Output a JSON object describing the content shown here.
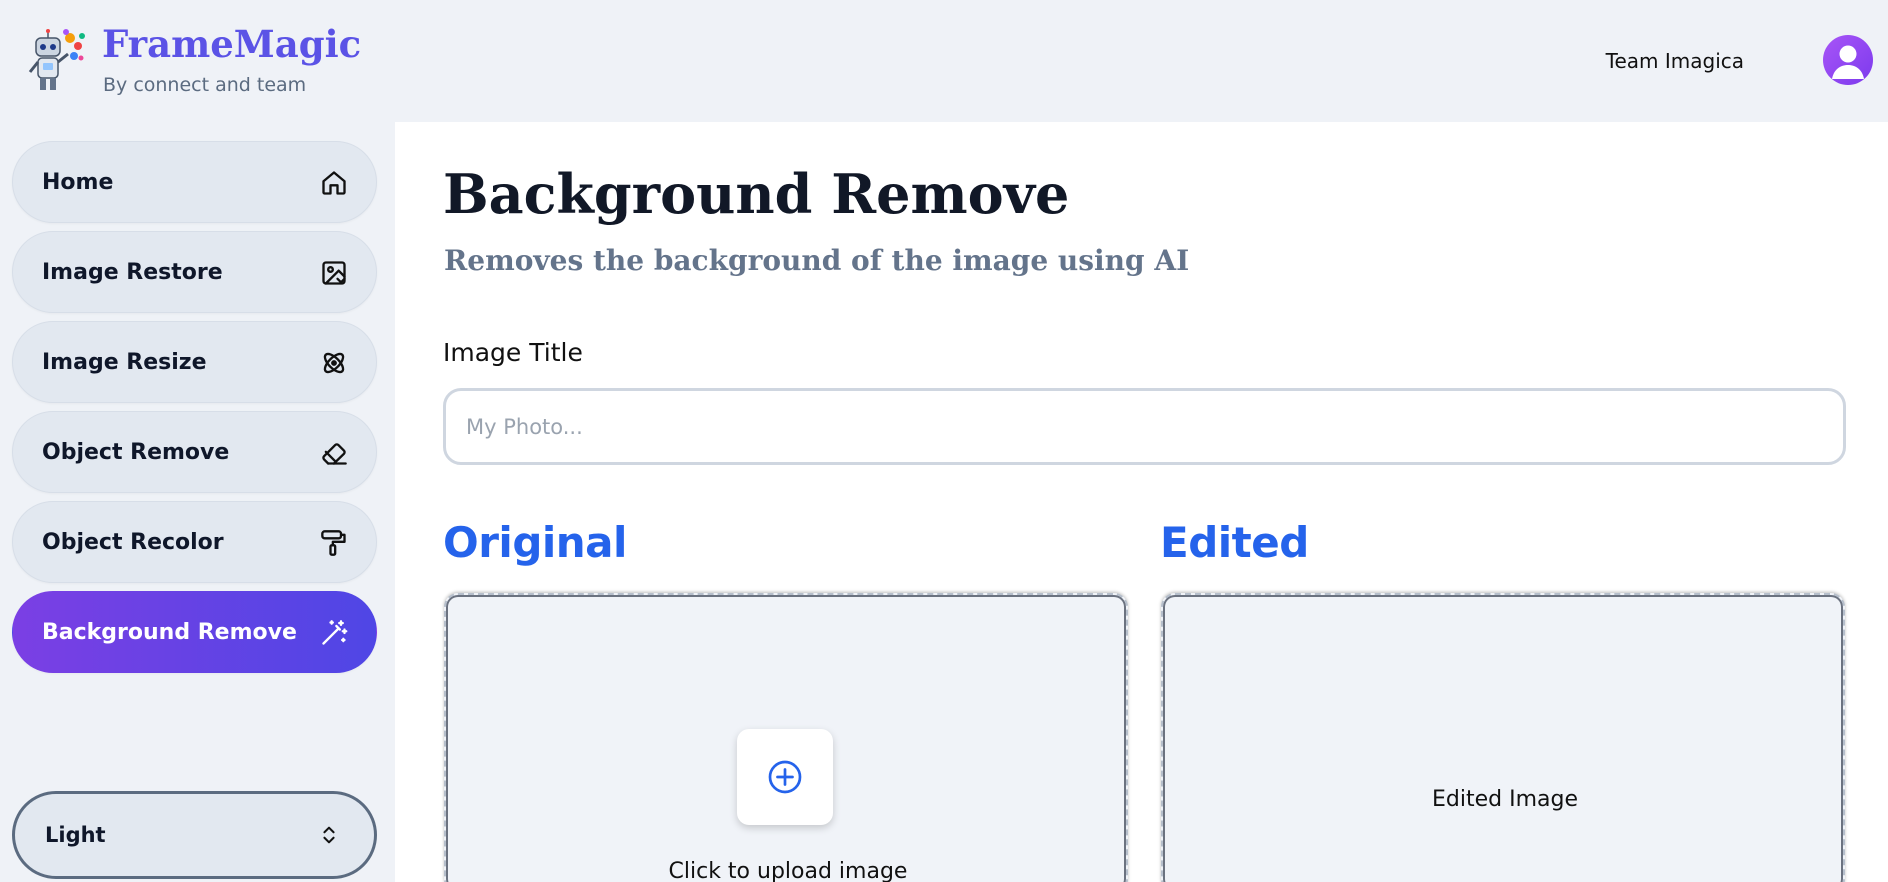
{
  "app": {
    "title": "FrameMagic",
    "subtitle": "By connect and team",
    "brand_color": "#5b53e6"
  },
  "user": {
    "name": "Team Imagica",
    "avatar_icon": "user-avatar-icon"
  },
  "sidebar": {
    "items": [
      {
        "label": "Home",
        "icon": "home-icon",
        "active": false
      },
      {
        "label": "Image Restore",
        "icon": "image-restore-icon",
        "active": false
      },
      {
        "label": "Image Resize",
        "icon": "resize-icon",
        "active": false
      },
      {
        "label": "Object Remove",
        "icon": "eraser-icon",
        "active": false
      },
      {
        "label": "Object Recolor",
        "icon": "paint-roller-icon",
        "active": false
      },
      {
        "label": "Background Remove",
        "icon": "magic-wand-icon",
        "active": true
      }
    ],
    "theme_select": {
      "value": "Light",
      "icon": "chevron-up-down-icon"
    }
  },
  "main": {
    "title": "Background Remove",
    "subtitle": "Removes the background of the image using AI",
    "image_title_label": "Image Title",
    "image_title_placeholder": "My Photo...",
    "image_title_value": "",
    "original": {
      "heading": "Original",
      "upload_text": "Click to upload image",
      "upload_icon": "plus-circle-icon"
    },
    "edited": {
      "heading": "Edited",
      "placeholder_text": "Edited Image"
    },
    "accent_color": "#2563eb"
  }
}
